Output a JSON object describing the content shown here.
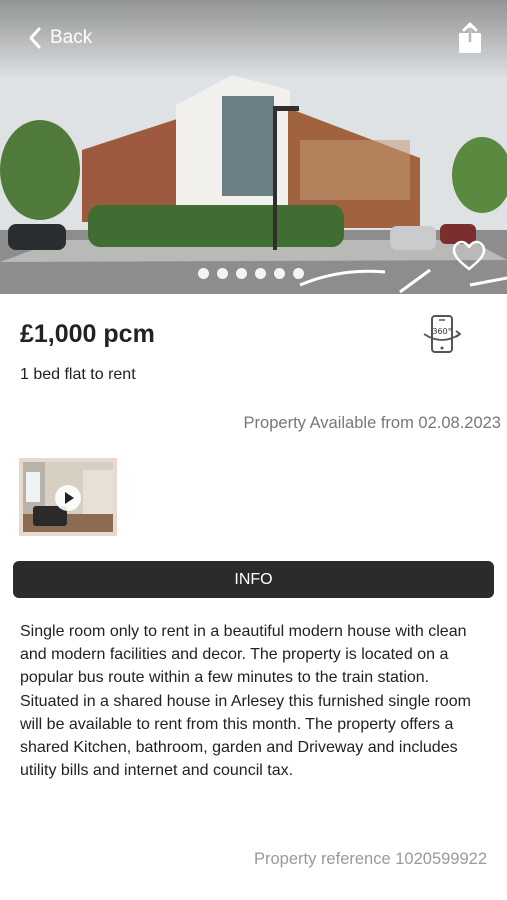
{
  "header": {
    "back_label": "Back"
  },
  "gallery": {
    "slide_count": 6
  },
  "listing": {
    "price": "£1,000 pcm",
    "subtitle": "1 bed flat to rent",
    "availability": "Property Available from 02.08.2023",
    "info_tab_label": "INFO",
    "description": "Single room only to rent in a beautiful modern house with clean and modern facilities and decor. The property is located on a popular bus route within a few minutes to the train station. Situated in a shared house in Arlesey this furnished single room will be available to rent from this month. The property offers a shared Kitchen, bathroom, garden and Driveway and includes utility bills and internet and council tax.",
    "reference": "Property reference 1020599922"
  },
  "icons": {
    "back": "chevron-left-icon",
    "share": "share-icon",
    "favourite": "heart-icon",
    "virtual_tour": "360-phone-icon",
    "video_play": "play-icon"
  },
  "colors": {
    "info_bar": "#2b2b2b",
    "secondary_text": "#777777",
    "reference_text": "#9a9a9a"
  }
}
